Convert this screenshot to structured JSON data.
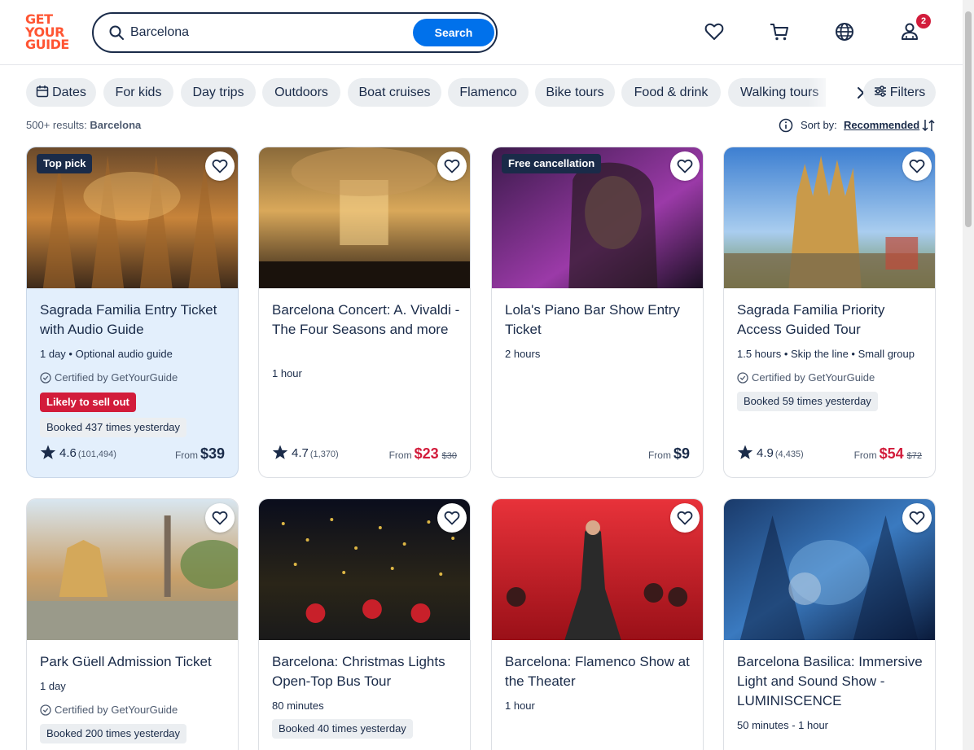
{
  "header": {
    "logo_lines": [
      "GET",
      "YOUR",
      "GUIDE"
    ],
    "search_value": "Barcelona",
    "search_button": "Search",
    "cart_badge": "2"
  },
  "chips": [
    "Dates",
    "For kids",
    "Day trips",
    "Outdoors",
    "Boat cruises",
    "Flamenco",
    "Bike tours",
    "Food & drink",
    "Walking tours"
  ],
  "filters_label": "Filters",
  "results": {
    "count": "500+ results:",
    "query": "Barcelona"
  },
  "sort": {
    "label": "Sort by:",
    "value": "Recommended"
  },
  "cards": [
    {
      "tag": "Top pick",
      "title": "Sagrada Familia Entry Ticket with Audio Guide",
      "sub": "1 day • Optional audio guide",
      "cert": "Certified by GetYourGuide",
      "sellout": "Likely to sell out",
      "booked": "Booked 437 times yesterday",
      "rating": "4.6",
      "rating_count": "(101,494)",
      "price_prefix": "From",
      "price": "$39"
    },
    {
      "title": "Barcelona Concert: A. Vivaldi - The Four Seasons and more",
      "sub": "1 hour",
      "rating": "4.7",
      "rating_count": "(1,370)",
      "price_prefix": "From",
      "price": "$23",
      "was": "$30"
    },
    {
      "tag": "Free cancellation",
      "title": "Lola's Piano Bar Show Entry Ticket",
      "sub": "2 hours",
      "price_prefix": "From",
      "price": "$9"
    },
    {
      "title": "Sagrada Familia Priority Access Guided Tour",
      "sub": "1.5 hours • Skip the line • Small group",
      "cert": "Certified by GetYourGuide",
      "booked": "Booked 59 times yesterday",
      "rating": "4.9",
      "rating_count": "(4,435)",
      "price_prefix": "From",
      "price": "$54",
      "was": "$72"
    },
    {
      "title": "Park Güell Admission Ticket",
      "sub": "1 day",
      "cert": "Certified by GetYourGuide",
      "booked": "Booked 200 times yesterday"
    },
    {
      "title": "Barcelona: Christmas Lights Open-Top Bus Tour",
      "sub": "80 minutes",
      "booked": "Booked 40 times yesterday"
    },
    {
      "title": "Barcelona: Flamenco Show at the Theater",
      "sub": "1 hour"
    },
    {
      "title": "Barcelona Basilica: Immersive Light and Sound Show - LUMINISCENCE",
      "sub": "50 minutes - 1 hour"
    }
  ],
  "colors": {
    "brand": "#ff5533",
    "primary_button": "#0071eb",
    "sale_price": "#d21c3b",
    "badge_red": "#d21c3b",
    "text": "#1a2b49",
    "highlight_card": "#e3effc"
  },
  "icons": [
    "search-icon",
    "heart-icon",
    "cart-icon",
    "globe-icon",
    "user-icon",
    "calendar-icon",
    "chevron-right-icon",
    "filters-icon",
    "info-icon",
    "sort-icon",
    "star-icon",
    "certified-icon"
  ]
}
